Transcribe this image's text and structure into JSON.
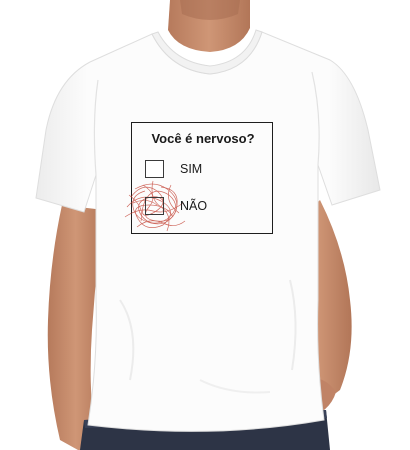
{
  "tshirt_print": {
    "question": "Você é nervoso?",
    "options": [
      {
        "label": "SIM",
        "checked": false
      },
      {
        "label": "NÃO",
        "checked": true
      }
    ],
    "scribble_color": "#c0392b"
  },
  "colors": {
    "shirt": "#fbfbfb",
    "skin": "#c88e6f",
    "jeans": "#2d3446",
    "background": "#ffffff"
  }
}
